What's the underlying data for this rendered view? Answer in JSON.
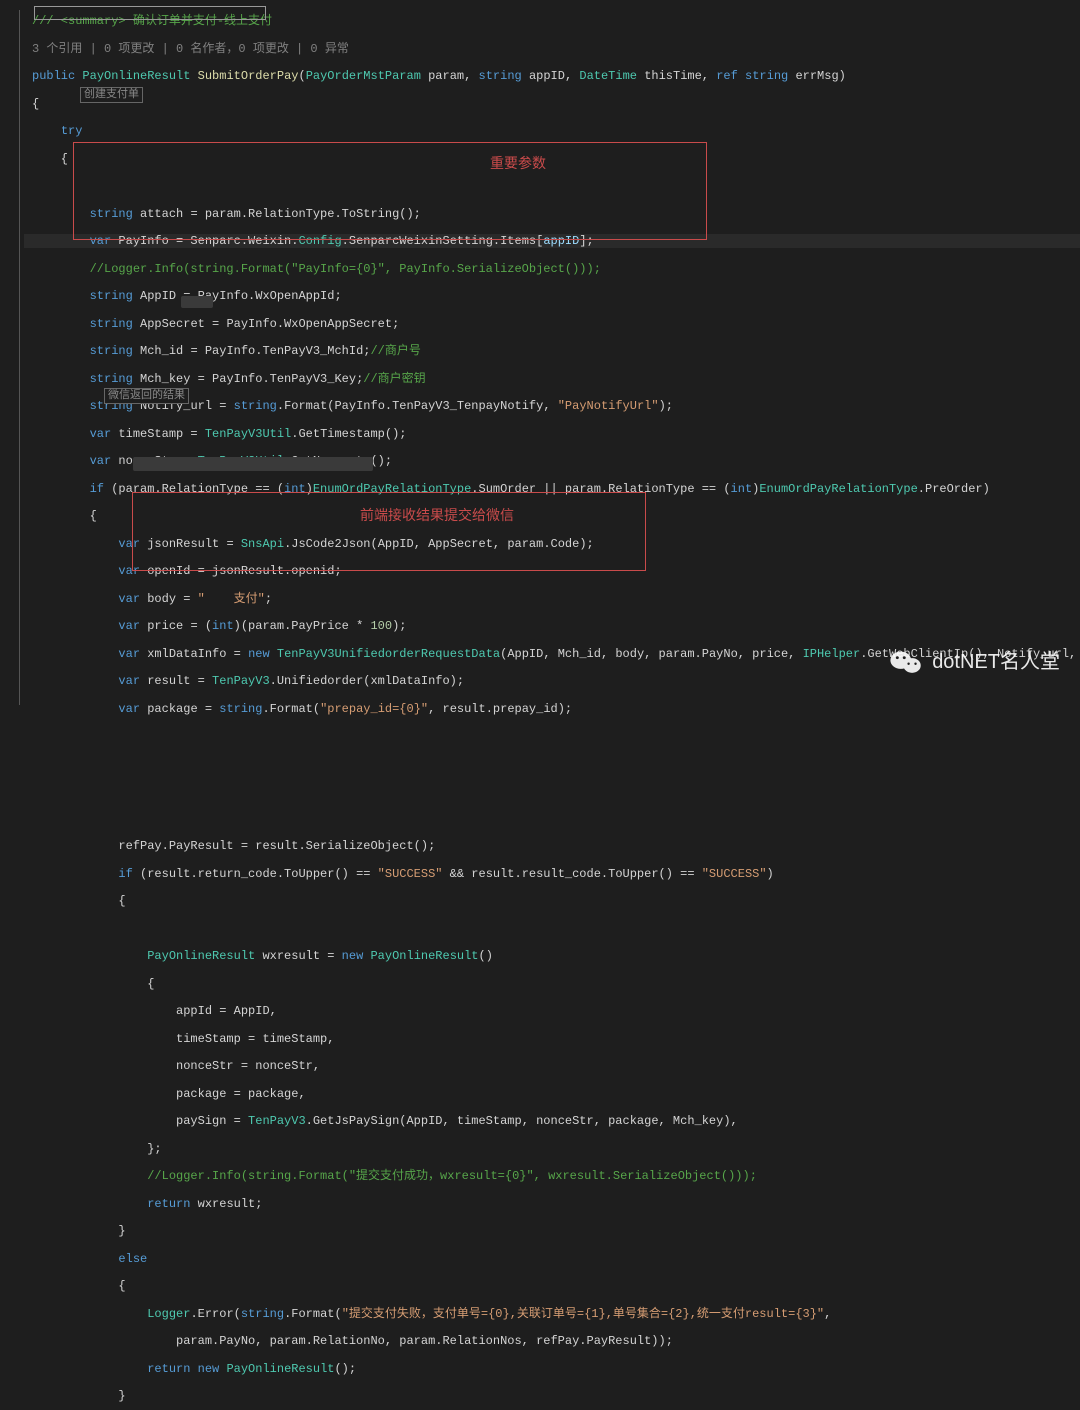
{
  "top_comment": "/// <summary> 确认订单并支付-线上支付",
  "refs_line": "3 个引用 | 0 项更改 | 0 名作者，0 项更改 | 0 异常",
  "method_sig": {
    "kw_public": "public",
    "ret_type": "PayOnlineResult",
    "name": "SubmitOrderPay",
    "p1_type": "PayOrderMstParam",
    "p1": "param",
    "p2_type": "string",
    "p2": "appID",
    "p3_type": "DateTime",
    "p3": "thisTime",
    "p4_kw": "ref",
    "p4_type": "string",
    "p4": "errMsg"
  },
  "kw": {
    "try": "try",
    "string": "string",
    "var": "var",
    "new": "new",
    "if": "if",
    "int": "int",
    "else": "else",
    "ref": "ref",
    "return": "return",
    "public": "public"
  },
  "box_label_1": "创建支付单",
  "box_label_2": "微信返回的结果",
  "lines": {
    "attach": "string attach = param.RelationType.ToString();",
    "payinfo": "var PayInfo = Senparc.Weixin.Config.SenparcWeixinSetting.Items[appID];",
    "logger1": "//Logger.Info(string.Format(\"PayInfo={0}\", PayInfo.SerializeObject()));",
    "appid": "string AppID = PayInfo.WxOpenAppId;",
    "appsecret": "string AppSecret = PayInfo.WxOpenAppSecret;",
    "mchid": "string Mch_id = PayInfo.TenPayV3_MchId;",
    "mchid_c": "//商户号",
    "mchkey": "string Mch_key = PayInfo.TenPayV3_Key;",
    "mchkey_c": "//商户密钥",
    "notify": "string Notify_url = string.Format(PayInfo.TenPayV3_TenpayNotify, \"PayNotifyUrl\");",
    "timestamp": "var timeStamp = TenPayV3Util.GetTimestamp();",
    "noncestr": "var nonceStr = TenPayV3Util.GetNoncestr();",
    "ifline": "if (param.RelationType == (int)EnumOrdPayRelationType.SumOrder || param.RelationType == (int)EnumOrdPayRelationType.PreOrder)",
    "jsonresult": "var jsonResult = SnsApi.JsCode2Json(AppID, AppSecret, param.Code);",
    "openid": "var openId = jsonResult.openid;",
    "body": "var body = \"    支付\";",
    "price": "var price = (int)(param.PayPrice * 100);",
    "xmldata": "var xmlDataInfo = new TenPayV3UnifiedorderRequestData(AppID, Mch_id, body, param.PayNo, price, IPHelper.GetWebClientIp(), Notify_url, Senparc.Weixin.TenPay.TenPayV",
    "result": "var result = TenPayV3.Unifiedorder(xmlDataInfo);",
    "package": "var package = string.Format(\"prepay_id={0}\", result.prepay_id);",
    "refpay": "refPay.PayResult = result.SerializeObject();",
    "ifsuccess": "if (result.return_code.ToUpper() == \"SUCCESS\" && result.result_code.ToUpper() == \"SUCCESS\")",
    "wxresult": "PayOnlineResult wxresult = new PayOnlineResult()",
    "a_appid": "appId = AppID,",
    "a_ts": "timeStamp = timeStamp,",
    "a_nonce": "nonceStr = nonceStr,",
    "a_pkg": "package = package,",
    "a_sign": "paySign = TenPayV3.GetJsPaySign(AppID, timeStamp, nonceStr, package, Mch_key),",
    "logger2": "//Logger.Info(string.Format(\"提交支付成功，wxresult={0}\", wxresult.SerializeObject()));",
    "return1": "return wxresult;",
    "loggererr": "Logger.Error(string.Format(\"提交支付失败，支付单号={0},关联订单号={1},单号集合={2},统一支付result={3}\",",
    "loggererr2": "param.PayNo, param.RelationNo, param.RelationNos, refPay.PayResult));",
    "return2": "return new PayOnlineResult();"
  },
  "anno1": "重要参数",
  "anno2": "前端接收结果提交给微信",
  "watermark": "dotNET名人堂"
}
